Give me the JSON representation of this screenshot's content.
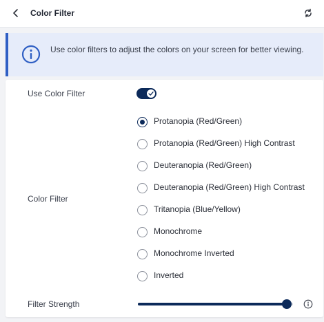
{
  "header": {
    "title": "Color Filter",
    "back_icon": "chevron-left-icon",
    "reset_icon": "refresh-icon"
  },
  "banner": {
    "icon": "info-icon",
    "text": "Use color filters to adjust the colors on your screen for better viewing."
  },
  "settings": {
    "use_color_filter": {
      "label": "Use Color Filter",
      "enabled": true
    },
    "color_filter": {
      "label": "Color Filter",
      "selected": "Protanopia (Red/Green)",
      "options": [
        "Protanopia (Red/Green)",
        "Protanopia (Red/Green) High Contrast",
        "Deuteranopia (Red/Green)",
        "Deuteranopia (Red/Green) High Contrast",
        "Tritanopia (Blue/Yellow)",
        "Monochrome",
        "Monochrome Inverted",
        "Inverted"
      ]
    },
    "filter_strength": {
      "label": "Filter Strength",
      "value_percent": 96,
      "info_icon": "info-icon"
    }
  },
  "colors": {
    "accent": "#0c2a5a",
    "banner_bg": "#e6ecfa",
    "banner_border": "#2f5fc4",
    "page_bg": "#f2f3f6"
  }
}
